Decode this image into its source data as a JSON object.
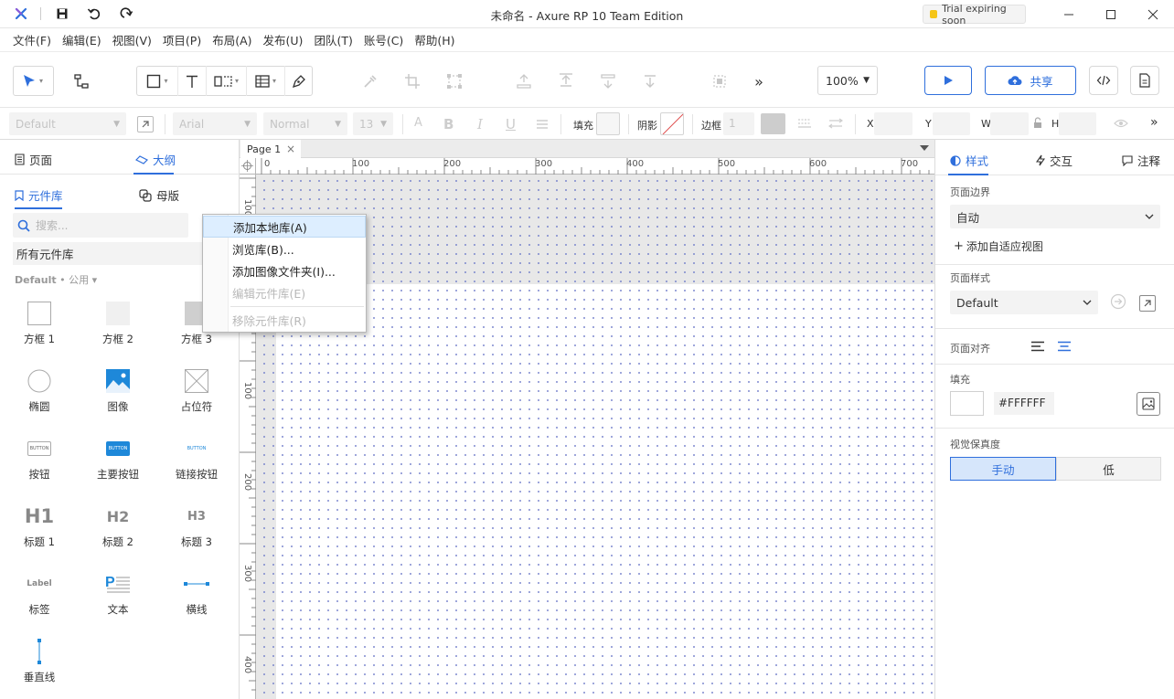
{
  "app": {
    "title": "未命名 - Axure RP 10 Team Edition",
    "trial_badge": "Trial expiring soon"
  },
  "menu": [
    "文件(F)",
    "编辑(E)",
    "视图(V)",
    "项目(P)",
    "布局(A)",
    "发布(U)",
    "团队(T)",
    "账号(C)",
    "帮助(H)"
  ],
  "toolbar": {
    "zoom": "100%",
    "share_label": "共享",
    "more": "»"
  },
  "formatbar": {
    "style": "Default",
    "font": "Arial",
    "weight": "Normal",
    "size": "13",
    "fill_label": "填充",
    "shadow_label": "阴影",
    "border_label": "边框",
    "border_value": "1",
    "x_label": "X",
    "y_label": "Y",
    "w_label": "W",
    "h_label": "H"
  },
  "left_panel": {
    "tabs": [
      "页面",
      "大纲"
    ],
    "subtabs": [
      "元件库",
      "母版"
    ],
    "search_placeholder": "搜索...",
    "library_select": "所有元件库",
    "library_header_name": "Default",
    "library_header_sub": "公用",
    "widgets": [
      "方框 1",
      "方框 2",
      "方框 3",
      "椭圆",
      "图像",
      "占位符",
      "按钮",
      "主要按钮",
      "链接按钮",
      "标题 1",
      "标题 2",
      "标题 3",
      "标签",
      "文本",
      "横线",
      "垂直线"
    ],
    "button_text": "BUTTON",
    "h1": "H1",
    "h2": "H2",
    "h3": "H3",
    "label_text": "Label"
  },
  "context_menu": {
    "items": [
      {
        "label": "添加本地库(A)",
        "state": "highlighted"
      },
      {
        "label": "浏览库(B)...",
        "state": "enabled"
      },
      {
        "label": "添加图像文件夹(I)...",
        "state": "enabled"
      },
      {
        "label": "编辑元件库(E)",
        "state": "disabled"
      },
      {
        "label": "移除元件库(R)",
        "state": "disabled"
      }
    ]
  },
  "canvas": {
    "page_tab": "Page 1",
    "h_ruler": [
      "0",
      "100",
      "200",
      "300",
      "400",
      "500",
      "600",
      "700"
    ],
    "v_ruler": [
      "100",
      "100",
      "200",
      "300",
      "400"
    ]
  },
  "right_panel": {
    "tabs": [
      "样式",
      "交互",
      "注释"
    ],
    "page_bounds_label": "页面边界",
    "page_bounds_value": "自动",
    "add_adaptive": "添加自适应视图",
    "page_style_label": "页面样式",
    "page_style_value": "Default",
    "page_align_label": "页面对齐",
    "fill_label": "填充",
    "fill_value": "#FFFFFF",
    "fidelity_label": "视觉保真度",
    "fidelity_options": [
      "手动",
      "低"
    ]
  },
  "colors": {
    "accent": "#2f6fdc",
    "canvas_dot": "#6c79c8",
    "trial_dot": "#f5c518"
  }
}
